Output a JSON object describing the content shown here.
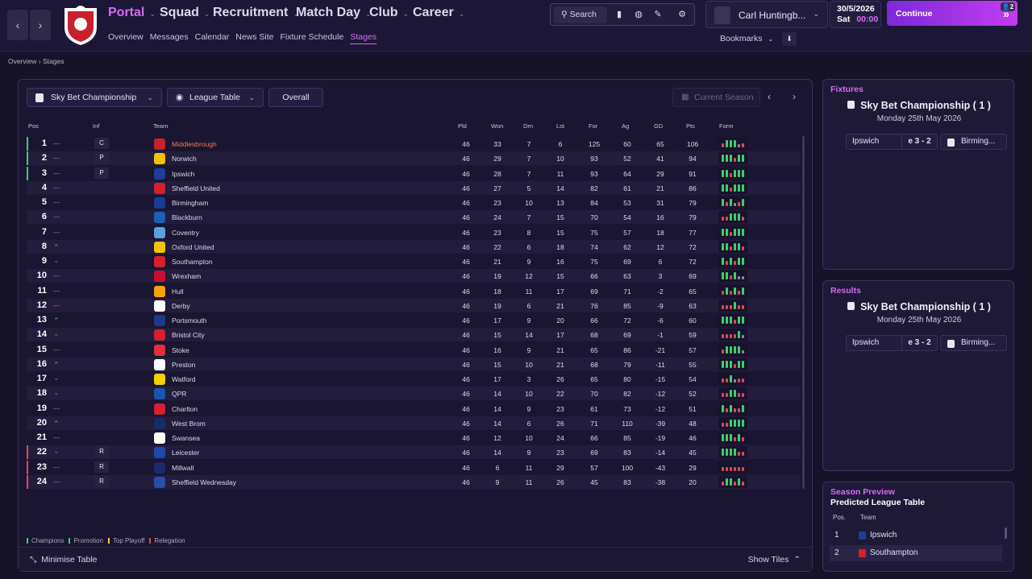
{
  "nav": {
    "items": [
      {
        "label": "Portal",
        "active": true
      },
      {
        "label": "Squad"
      },
      {
        "label": "Recruitment"
      },
      {
        "label": "Match Day"
      },
      {
        "label": "Club"
      },
      {
        "label": "Career"
      }
    ],
    "subitems": [
      "Overview",
      "Messages",
      "Calendar",
      "News Site",
      "Fixture Schedule",
      "Stages"
    ],
    "active_sub": "Stages",
    "search_label": "Search",
    "user_name": "Carl Huntingb...",
    "date": "30/5/2026",
    "day": "Sat",
    "time": "00:00",
    "continue_label": "Continue",
    "continue_badge": "2",
    "bookmarks_label": "Bookmarks"
  },
  "breadcrumb": {
    "root": "Overview",
    "current": "Stages"
  },
  "table_controls": {
    "competition": "Sky Bet Championship",
    "view": "League Table",
    "scope": "Overall",
    "season_placeholder": "Current Season"
  },
  "columns": {
    "pos": "Pos",
    "inf": "Inf",
    "team": "Team",
    "pld": "Pld",
    "won": "Won",
    "drn": "Drn",
    "lst": "Lst",
    "for": "For",
    "ag": "Ag",
    "gd": "GD",
    "pts": "Pts",
    "form": "Form"
  },
  "rows": [
    {
      "pos": "1",
      "move": "same",
      "inf": "C",
      "team": "Middlesbrough",
      "pld": "46",
      "won": "33",
      "drn": "7",
      "lst": "6",
      "for": "125",
      "ag": "60",
      "gd": "65",
      "pts": "106",
      "zone": "champ",
      "crest": "#c8202c",
      "form": "LWWWDL",
      "highlight": true
    },
    {
      "pos": "2",
      "move": "same",
      "inf": "P",
      "team": "Norwich",
      "pld": "46",
      "won": "29",
      "drn": "7",
      "lst": "10",
      "for": "93",
      "ag": "52",
      "gd": "41",
      "pts": "94",
      "zone": "promo",
      "crest": "#f2c200",
      "form": "WWWLWW"
    },
    {
      "pos": "3",
      "move": "same",
      "inf": "P",
      "team": "Ipswich",
      "pld": "46",
      "won": "28",
      "drn": "7",
      "lst": "11",
      "for": "93",
      "ag": "64",
      "gd": "29",
      "pts": "91",
      "zone": "promo",
      "crest": "#1b3f9a",
      "form": "WWLWWW"
    },
    {
      "pos": "4",
      "move": "same",
      "inf": "",
      "team": "Sheffield United",
      "pld": "46",
      "won": "27",
      "drn": "5",
      "lst": "14",
      "for": "82",
      "ag": "61",
      "gd": "21",
      "pts": "86",
      "zone": "",
      "crest": "#d42030",
      "form": "WWLWWW"
    },
    {
      "pos": "5",
      "move": "same",
      "inf": "",
      "team": "Birmingham",
      "pld": "46",
      "won": "23",
      "drn": "10",
      "lst": "13",
      "for": "84",
      "ag": "53",
      "gd": "31",
      "pts": "79",
      "zone": "",
      "crest": "#1a3c96",
      "form": "WLWDLW"
    },
    {
      "pos": "6",
      "move": "same",
      "inf": "",
      "team": "Blackburn",
      "pld": "46",
      "won": "24",
      "drn": "7",
      "lst": "15",
      "for": "70",
      "ag": "54",
      "gd": "16",
      "pts": "79",
      "zone": "",
      "crest": "#1c5fb4",
      "form": "LLWWWL"
    },
    {
      "pos": "7",
      "move": "same",
      "inf": "",
      "team": "Coventry",
      "pld": "46",
      "won": "23",
      "drn": "8",
      "lst": "15",
      "for": "75",
      "ag": "57",
      "gd": "18",
      "pts": "77",
      "zone": "",
      "crest": "#5aa0e0",
      "form": "WWLWWW"
    },
    {
      "pos": "8",
      "move": "up",
      "inf": "",
      "team": "Oxford United",
      "pld": "46",
      "won": "22",
      "drn": "6",
      "lst": "18",
      "for": "74",
      "ag": "62",
      "gd": "12",
      "pts": "72",
      "zone": "",
      "crest": "#f2c500",
      "form": "WWLWWL"
    },
    {
      "pos": "9",
      "move": "down",
      "inf": "",
      "team": "Southampton",
      "pld": "46",
      "won": "21",
      "drn": "9",
      "lst": "16",
      "for": "75",
      "ag": "69",
      "gd": "6",
      "pts": "72",
      "zone": "",
      "crest": "#d8202c",
      "form": "WLWLWW"
    },
    {
      "pos": "10",
      "move": "same",
      "inf": "",
      "team": "Wrexham",
      "pld": "46",
      "won": "19",
      "drn": "12",
      "lst": "15",
      "for": "66",
      "ag": "63",
      "gd": "3",
      "pts": "69",
      "zone": "",
      "crest": "#c8102e",
      "form": "WWLWDD"
    },
    {
      "pos": "11",
      "move": "same",
      "inf": "",
      "team": "Hull",
      "pld": "46",
      "won": "18",
      "drn": "11",
      "lst": "17",
      "for": "69",
      "ag": "71",
      "gd": "-2",
      "pts": "65",
      "zone": "",
      "crest": "#f5a300",
      "form": "LWLWLW"
    },
    {
      "pos": "12",
      "move": "same",
      "inf": "",
      "team": "Derby",
      "pld": "46",
      "won": "19",
      "drn": "6",
      "lst": "21",
      "for": "76",
      "ag": "85",
      "gd": "-9",
      "pts": "63",
      "zone": "",
      "crest": "#ffffff",
      "form": "LLLWLL"
    },
    {
      "pos": "13",
      "move": "up",
      "inf": "",
      "team": "Portsmouth",
      "pld": "46",
      "won": "17",
      "drn": "9",
      "lst": "20",
      "for": "66",
      "ag": "72",
      "gd": "-6",
      "pts": "60",
      "zone": "",
      "crest": "#1c3a8a",
      "form": "WWWLWW"
    },
    {
      "pos": "14",
      "move": "down",
      "inf": "",
      "team": "Bristol City",
      "pld": "46",
      "won": "15",
      "drn": "14",
      "lst": "17",
      "for": "68",
      "ag": "69",
      "gd": "-1",
      "pts": "59",
      "zone": "",
      "crest": "#d42030",
      "form": "LLLLWD"
    },
    {
      "pos": "15",
      "move": "same",
      "inf": "",
      "team": "Stoke",
      "pld": "46",
      "won": "16",
      "drn": "9",
      "lst": "21",
      "for": "65",
      "ag": "86",
      "gd": "-21",
      "pts": "57",
      "zone": "",
      "crest": "#e03040",
      "form": "LWWWWD"
    },
    {
      "pos": "16",
      "move": "up",
      "inf": "",
      "team": "Preston",
      "pld": "46",
      "won": "15",
      "drn": "10",
      "lst": "21",
      "for": "68",
      "ag": "79",
      "gd": "-11",
      "pts": "55",
      "zone": "",
      "crest": "#ffffff",
      "form": "WWWLWW"
    },
    {
      "pos": "17",
      "move": "down",
      "inf": "",
      "team": "Watford",
      "pld": "46",
      "won": "17",
      "drn": "3",
      "lst": "26",
      "for": "65",
      "ag": "80",
      "gd": "-15",
      "pts": "54",
      "zone": "",
      "crest": "#f5d000",
      "form": "LLWDLL"
    },
    {
      "pos": "18",
      "move": "down",
      "inf": "",
      "team": "QPR",
      "pld": "46",
      "won": "14",
      "drn": "10",
      "lst": "22",
      "for": "70",
      "ag": "82",
      "gd": "-12",
      "pts": "52",
      "zone": "",
      "crest": "#1a56b0",
      "form": "LLWWLL"
    },
    {
      "pos": "19",
      "move": "same",
      "inf": "",
      "team": "Charlton",
      "pld": "46",
      "won": "14",
      "drn": "9",
      "lst": "23",
      "for": "61",
      "ag": "73",
      "gd": "-12",
      "pts": "51",
      "zone": "",
      "crest": "#d42030",
      "form": "WLWLLW"
    },
    {
      "pos": "20",
      "move": "up",
      "inf": "",
      "team": "West Brom",
      "pld": "46",
      "won": "14",
      "drn": "6",
      "lst": "26",
      "for": "71",
      "ag": "110",
      "gd": "-39",
      "pts": "48",
      "zone": "",
      "crest": "#1c2a6a",
      "form": "LLWWWW"
    },
    {
      "pos": "21",
      "move": "same",
      "inf": "",
      "team": "Swansea",
      "pld": "46",
      "won": "12",
      "drn": "10",
      "lst": "24",
      "for": "66",
      "ag": "85",
      "gd": "-19",
      "pts": "46",
      "zone": "",
      "crest": "#ffffff",
      "form": "WWWLWL"
    },
    {
      "pos": "22",
      "move": "down",
      "inf": "R",
      "team": "Leicester",
      "pld": "46",
      "won": "14",
      "drn": "9",
      "lst": "23",
      "for": "69",
      "ag": "83",
      "gd": "-14",
      "pts": "45",
      "zone": "releg",
      "crest": "#1a4aa8",
      "form": "WWWWLL"
    },
    {
      "pos": "23",
      "move": "same",
      "inf": "R",
      "team": "Millwall",
      "pld": "46",
      "won": "6",
      "drn": "11",
      "lst": "29",
      "for": "57",
      "ag": "100",
      "gd": "-43",
      "pts": "29",
      "zone": "releg",
      "crest": "#1c2a6a",
      "form": "LLLLLL"
    },
    {
      "pos": "24",
      "move": "same",
      "inf": "R",
      "team": "Sheffield Wednesday",
      "pld": "46",
      "won": "9",
      "drn": "11",
      "lst": "26",
      "for": "45",
      "ag": "83",
      "gd": "-38",
      "pts": "20",
      "zone": "releg",
      "crest": "#2450a8",
      "form": "LWWLWL"
    }
  ],
  "legend": [
    "Champions",
    "Promotion",
    "Top Playoff",
    "Relegation"
  ],
  "colors": {
    "accent": "#d66cf2",
    "champ": "#3fcf6a",
    "promo": "#3fcf6a",
    "playoff": "#f2d23a",
    "releg": "#e0485a",
    "win": "#3fcf6a",
    "loss": "#e0485a",
    "draw": "#8b8aa0"
  },
  "footer": {
    "minimise": "Minimise Table",
    "show_tiles": "Show Tiles"
  },
  "fixtures": {
    "title": "Fixtures",
    "competition": "Sky Bet Championship ( 1 )",
    "date": "Monday 25th May 2026",
    "home": "Ipswich",
    "score": "e 3 - 2",
    "away": "Birming..."
  },
  "results": {
    "title": "Results",
    "competition": "Sky Bet Championship ( 1 )",
    "date": "Monday 25th May 2026",
    "home": "Ipswich",
    "score": "e 3 - 2",
    "away": "Birming..."
  },
  "season_preview": {
    "title": "Season Preview",
    "subtitle": "Predicted League Table",
    "col_pos": "Pos.",
    "col_team": "Team",
    "rows": [
      {
        "pos": "1",
        "team": "Ipswich",
        "crest": "#1b3f9a"
      },
      {
        "pos": "2",
        "team": "Southampton",
        "crest": "#d8202c"
      }
    ]
  }
}
